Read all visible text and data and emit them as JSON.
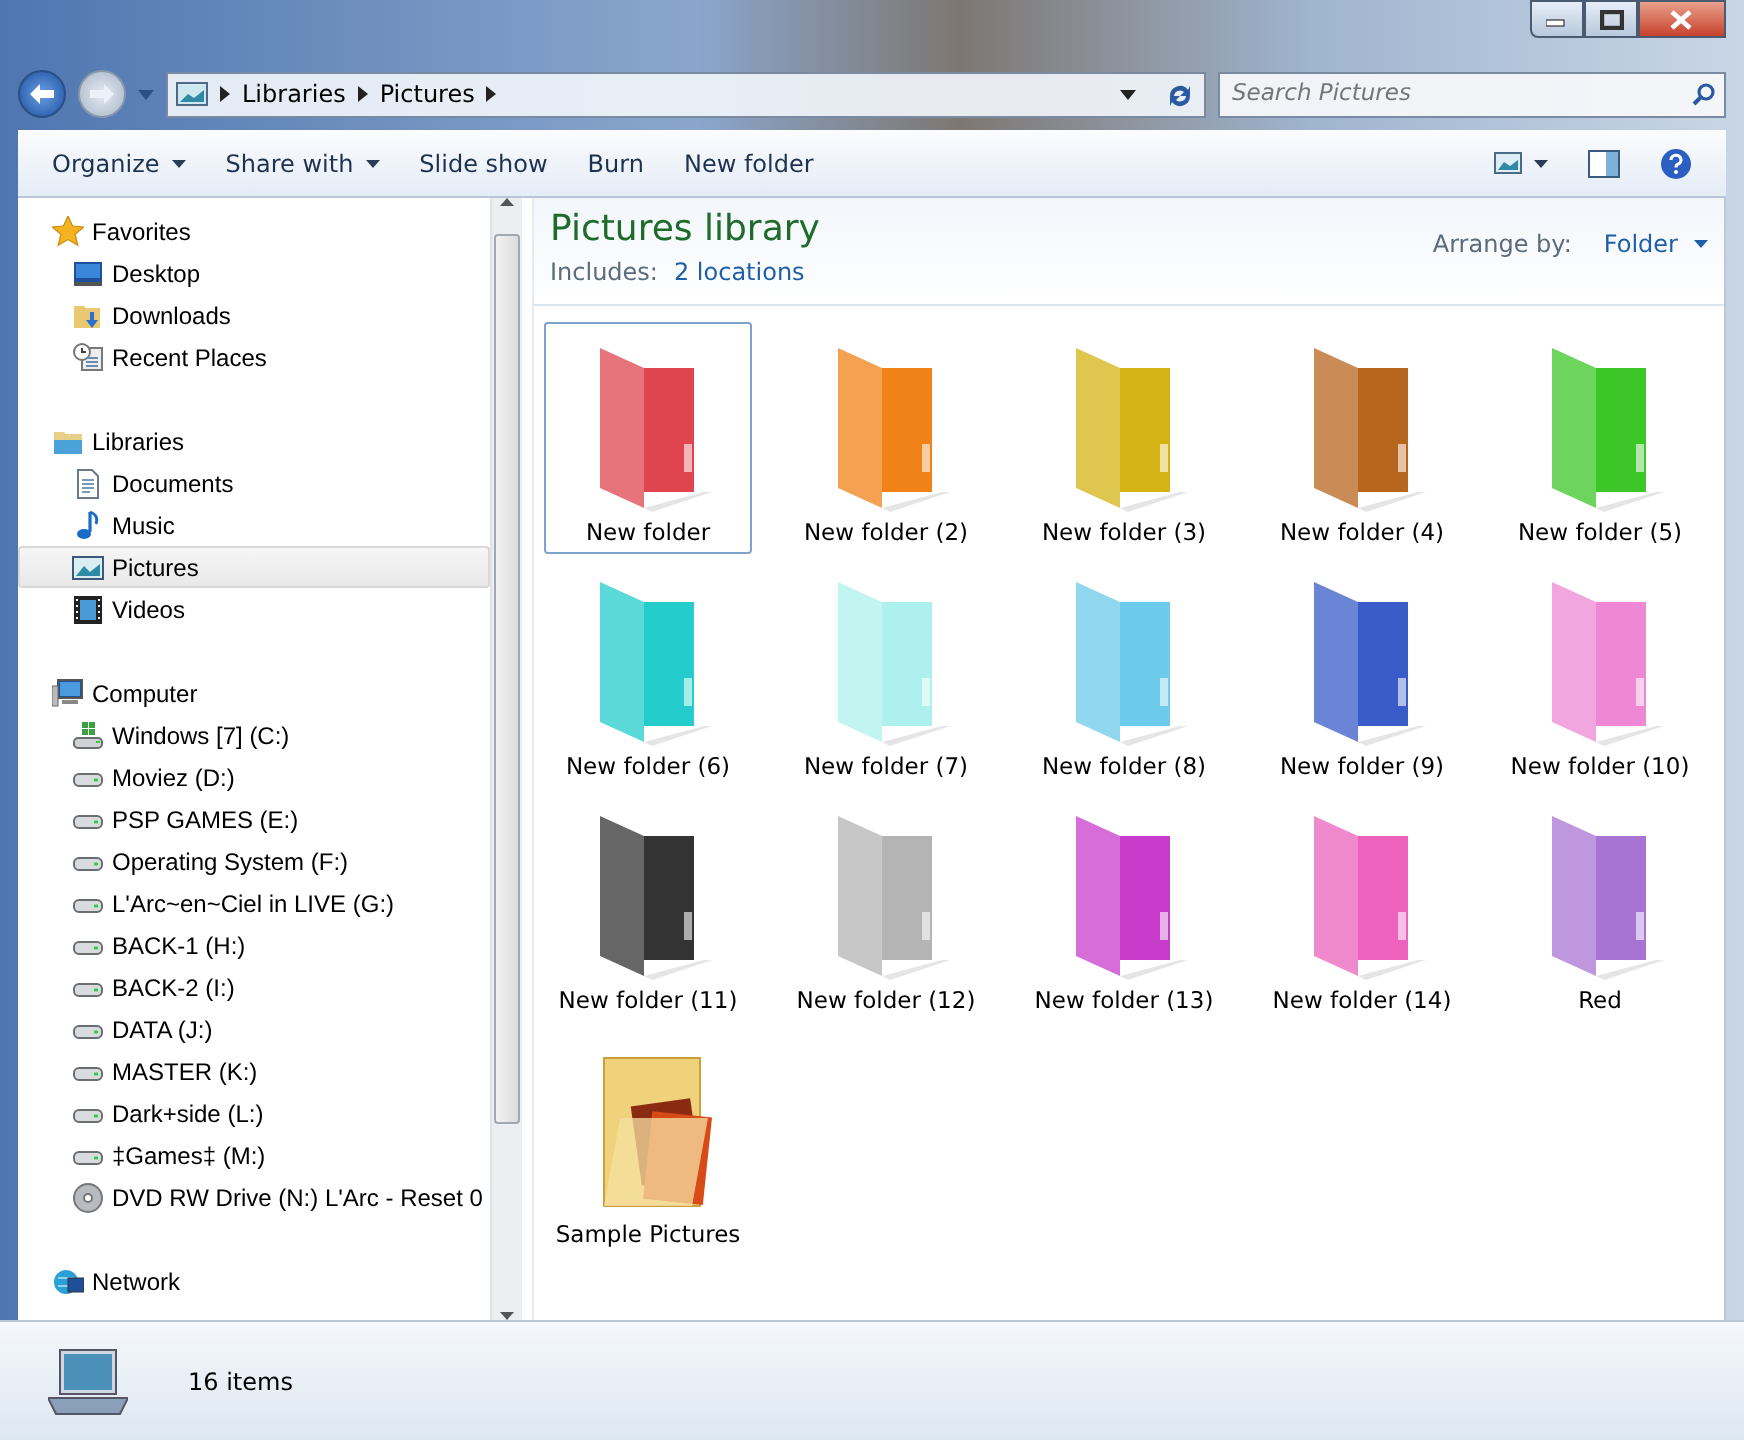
{
  "address": {
    "crumbs": [
      "Libraries",
      "Pictures"
    ],
    "search_placeholder": "Search Pictures"
  },
  "toolbar": [
    {
      "label": "Organize",
      "dropdown": true
    },
    {
      "label": "Share with",
      "dropdown": true
    },
    {
      "label": "Slide show",
      "dropdown": false
    },
    {
      "label": "Burn",
      "dropdown": false
    },
    {
      "label": "New folder",
      "dropdown": false
    }
  ],
  "sidebar": {
    "groups": [
      {
        "label": "Favorites",
        "kind": "star",
        "children": [
          {
            "label": "Desktop",
            "kind": "desktop",
            "selected": false
          },
          {
            "label": "Downloads",
            "kind": "downloads",
            "selected": false
          },
          {
            "label": "Recent Places",
            "kind": "recent",
            "selected": false
          }
        ]
      },
      {
        "label": "Libraries",
        "kind": "library",
        "children": [
          {
            "label": "Documents",
            "kind": "document",
            "selected": false
          },
          {
            "label": "Music",
            "kind": "music",
            "selected": false
          },
          {
            "label": "Pictures",
            "kind": "picture",
            "selected": true
          },
          {
            "label": "Videos",
            "kind": "video",
            "selected": false
          }
        ]
      },
      {
        "label": "Computer",
        "kind": "computer",
        "children": [
          {
            "label": "Windows [7] (C:)",
            "kind": "system-drive",
            "selected": false
          },
          {
            "label": "Moviez (D:)",
            "kind": "drive",
            "selected": false
          },
          {
            "label": "PSP GAMES (E:)",
            "kind": "drive",
            "selected": false
          },
          {
            "label": "Operating System (F:)",
            "kind": "drive",
            "selected": false
          },
          {
            "label": "L'Arc~en~Ciel in LIVE (G:)",
            "kind": "drive",
            "selected": false
          },
          {
            "label": "BACK-1 (H:)",
            "kind": "drive",
            "selected": false
          },
          {
            "label": "BACK-2 (I:)",
            "kind": "drive",
            "selected": false
          },
          {
            "label": "DATA (J:)",
            "kind": "drive",
            "selected": false
          },
          {
            "label": "MASTER (K:)",
            "kind": "drive",
            "selected": false
          },
          {
            "label": "Dark+side (L:)",
            "kind": "drive",
            "selected": false
          },
          {
            "label": "‡Games‡ (M:)",
            "kind": "drive",
            "selected": false
          },
          {
            "label": "DVD RW Drive (N:) L'Arc - Reset 0",
            "kind": "disc",
            "selected": false
          }
        ]
      },
      {
        "label": "Network",
        "kind": "network"
      }
    ]
  },
  "library": {
    "title": "Pictures library",
    "includes_label": "Includes:",
    "includes_link": "2 locations",
    "arrange_label": "Arrange by:",
    "arrange_value": "Folder"
  },
  "items": [
    {
      "name": "New folder",
      "kind": "folder",
      "color": "#e0454f",
      "selected": true
    },
    {
      "name": "New folder (2)",
      "kind": "folder",
      "color": "#f08218",
      "selected": false
    },
    {
      "name": "New folder (3)",
      "kind": "folder",
      "color": "#d4b414",
      "selected": false
    },
    {
      "name": "New folder (4)",
      "kind": "folder",
      "color": "#b8661e",
      "selected": false
    },
    {
      "name": "New folder (5)",
      "kind": "folder",
      "color": "#3cc628",
      "selected": false
    },
    {
      "name": "New folder (6)",
      "kind": "folder",
      "color": "#24cccc",
      "selected": false
    },
    {
      "name": "New folder (7)",
      "kind": "folder",
      "color": "#aef0ee",
      "selected": false
    },
    {
      "name": "New folder (8)",
      "kind": "folder",
      "color": "#6ccaea",
      "selected": false
    },
    {
      "name": "New folder (9)",
      "kind": "folder",
      "color": "#3a5cc8",
      "selected": false
    },
    {
      "name": "New folder (10)",
      "kind": "folder",
      "color": "#ee88d4",
      "selected": false
    },
    {
      "name": "New folder (11)",
      "kind": "folder",
      "color": "#333333",
      "selected": false
    },
    {
      "name": "New folder (12)",
      "kind": "folder",
      "color": "#b4b4b4",
      "selected": false
    },
    {
      "name": "New folder (13)",
      "kind": "folder",
      "color": "#c83ccc",
      "selected": false
    },
    {
      "name": "New folder (14)",
      "kind": "folder",
      "color": "#ec62bc",
      "selected": false
    },
    {
      "name": "Red",
      "kind": "folder",
      "color": "#a874d4",
      "selected": false
    },
    {
      "name": "Sample Pictures",
      "kind": "photo-folder",
      "color": "#f0d27a",
      "selected": false
    }
  ],
  "status_bar": {
    "count": "16 items"
  }
}
